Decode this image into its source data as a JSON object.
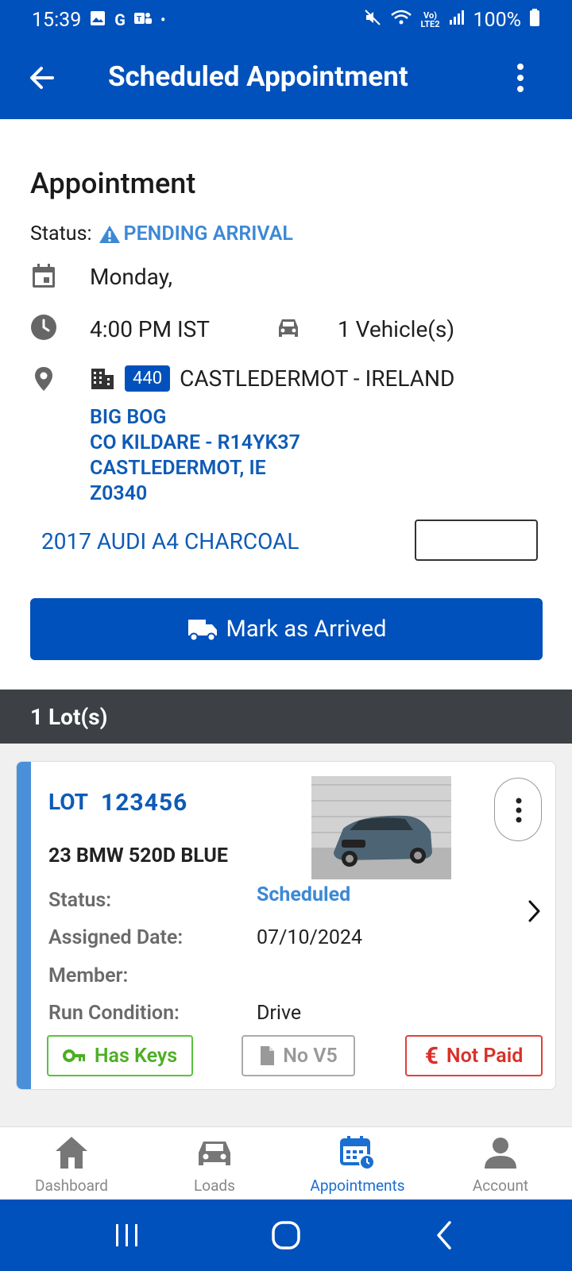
{
  "status_bar": {
    "time": "15:39",
    "left_icons": [
      "gallery-icon",
      "google-icon",
      "teams-icon",
      "dot-icon"
    ],
    "battery": "100%",
    "right_icons": [
      "mute-icon",
      "wifi-icon",
      "volte-icon",
      "signal-icon",
      "battery-icon"
    ]
  },
  "app_bar": {
    "title": "Scheduled Appointment"
  },
  "appointment": {
    "heading": "Appointment",
    "status_label": "Status:",
    "status_value": "PENDING ARRIVAL",
    "date": "Monday,",
    "time": "4:00 PM IST",
    "vehicles": "1 Vehicle(s)",
    "location_code": "440",
    "location_name": "CASTLEDERMOT - IRELAND",
    "address_line1": "BIG BOG",
    "address_line2": "CO KILDARE - R14YK37",
    "address_line3": "CASTLEDERMOT, IE",
    "address_line4": "Z0340",
    "vehicle_desc": "2017 AUDI A4 CHARCOAL",
    "vin_input_value": "",
    "mark_arrived_label": "Mark as Arrived"
  },
  "lots": {
    "header": "1 Lot(s)",
    "items": [
      {
        "lot_label": "LOT",
        "lot_number": "123456",
        "title": "23 BMW 520D BLUE",
        "status_label": "Status:",
        "status_value": "Scheduled",
        "assigned_date_label": "Assigned Date:",
        "assigned_date_value": "07/10/2024",
        "member_label": "Member:",
        "member_value": "",
        "run_condition_label": "Run Condition:",
        "run_condition_value": "Drive",
        "tag_keys": "Has Keys",
        "tag_v5": "No V5",
        "tag_paid": "Not Paid"
      }
    ]
  },
  "bottom_nav": {
    "items": [
      {
        "label": "Dashboard",
        "icon": "home-icon"
      },
      {
        "label": "Loads",
        "icon": "car-icon"
      },
      {
        "label": "Appointments",
        "icon": "calendar-clock-icon",
        "active": true
      },
      {
        "label": "Account",
        "icon": "person-icon"
      }
    ]
  },
  "colors": {
    "primary": "#0051bb",
    "link": "#0e5bb6",
    "status_blue": "#3d88d4",
    "keys_green": "#4caf22",
    "not_paid_red": "#d93028",
    "lots_header_bg": "#3d4146"
  }
}
